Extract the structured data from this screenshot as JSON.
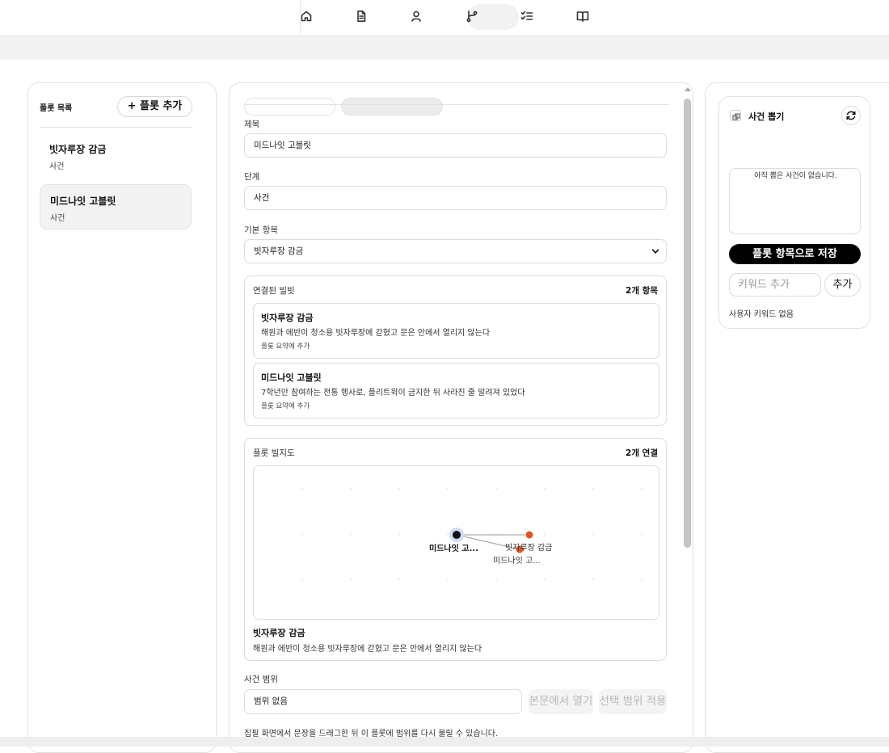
{
  "nav": {
    "items": [
      {
        "icon": "home-icon"
      },
      {
        "icon": "document-icon"
      },
      {
        "icon": "user-icon"
      },
      {
        "icon": "branch-icon",
        "active": true
      },
      {
        "icon": "checklist-icon"
      },
      {
        "icon": "book-icon"
      }
    ]
  },
  "sidebar": {
    "header": "플롯 목록",
    "add_button": "+ 플롯 추가",
    "plots": [
      {
        "title": "빗자루장 감금",
        "subtitle": "사건"
      },
      {
        "title": "미드나잇 고블릿",
        "subtitle": "사건",
        "active": true
      }
    ]
  },
  "editor": {
    "title_label": "제목",
    "title_value": "미드나잇 고블릿",
    "stage_label": "단계",
    "stage_value": "사건",
    "base_label": "기본 항목",
    "base_value": "빗자루장 감금",
    "linked": {
      "label": "연결된 빌빗",
      "count": "2개 항목",
      "beats": [
        {
          "title": "빗자루장 감금",
          "desc": "해원과 에반이 청소용 빗자루장에 갇혔고 문은 안에서 열리지 않는다",
          "action": "플롯 요약에 추가"
        },
        {
          "title": "미드나잇 고블릿",
          "desc": "7학년만 참여하는 전통 행사로, 플리트윅이 금지한 뒤 사라진 줄 알려져 있었다",
          "action": "플롯 요약에 추가"
        }
      ]
    },
    "map": {
      "label": "플롯 빌지도",
      "count": "2개 연결",
      "nodes": [
        {
          "label": "미드나잇 고...",
          "color": "#111111",
          "selected": true
        },
        {
          "label": "빗자루장 감금",
          "color": "#e8531c"
        },
        {
          "label": "미드나잇 고...",
          "color": "#e8531c"
        }
      ],
      "selected_title": "빗자루장 감금",
      "selected_desc": "해원과 에반이 청소용 빗자루장에 갇혔고 문은 안에서 열리지 않는다"
    },
    "range": {
      "label": "사건 범위",
      "value": "범위 없음",
      "open_button": "본문에서 열기",
      "apply_button": "선택 범위 적용",
      "hint": "집필 화면에서 문장을 드래그한 뒤 이 플롯에 범위를 다시 불릴 수 있습니다."
    }
  },
  "event_picker": {
    "title": "사건 뽑기",
    "empty": "아직 뽑은 사건이 없습니다.",
    "save_button": "플롯 항목으로 저장",
    "keyword_placeholder": "키워드 추가",
    "keyword_add": "추가",
    "no_keywords": "사용자 키워드 없음"
  },
  "colors": {
    "accent": "#000000",
    "node_orange": "#e8531c",
    "panel_border": "#e2e2e2"
  }
}
